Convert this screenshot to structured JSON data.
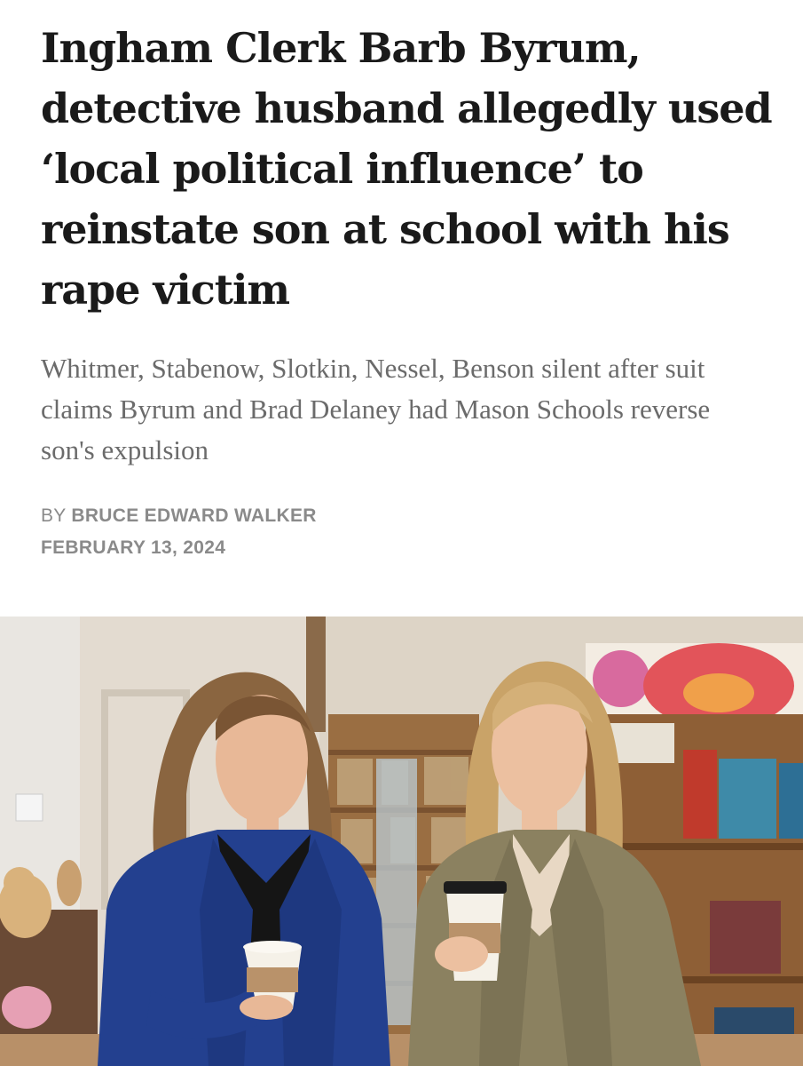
{
  "article": {
    "headline": "Ingham Clerk Barb Byrum, detective husband allegedly used ‘local political influence’ to reinstate son at school with his rape victim",
    "subheadline": "Whitmer, Stabenow, Slotkin, Nessel, Benson silent after suit claims Byrum and Brad Delaney had Mason Schools reverse son's expulsion",
    "byline_prefix": "BY ",
    "author": "BRUCE EDWARD WALKER",
    "date": "FEBRUARY 13, 2024"
  },
  "colors": {
    "headline": "#1a1a1a",
    "subheadline": "#6b6b6b",
    "meta": "#8a8a8a"
  }
}
